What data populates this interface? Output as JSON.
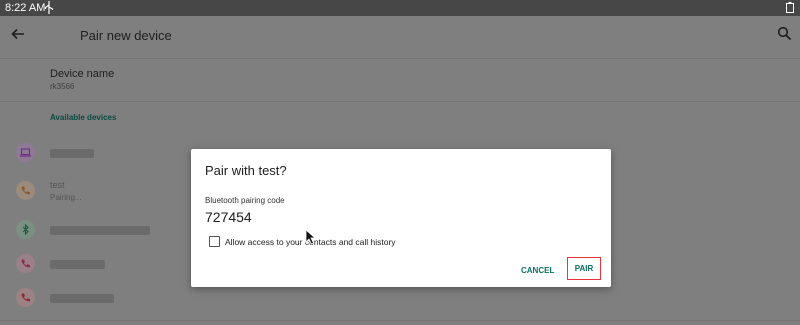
{
  "status_bar": {
    "time": "8:22 AM"
  },
  "header": {
    "title": "Pair new device"
  },
  "device_name": {
    "label": "Device name",
    "value": "rk3566"
  },
  "available_devices": {
    "title": "Available devices",
    "items": [
      {
        "icon": "laptop-icon",
        "name": "",
        "status": ""
      },
      {
        "icon": "phone-icon",
        "name": "test",
        "status": "Pairing..."
      },
      {
        "icon": "bluetooth-icon",
        "name": "",
        "status": ""
      },
      {
        "icon": "phone-icon",
        "name": "",
        "status": ""
      },
      {
        "icon": "phone-icon",
        "name": "",
        "status": ""
      }
    ]
  },
  "dialog": {
    "title": "Pair with test?",
    "code_label": "Bluetooth pairing code",
    "code": "727454",
    "checkbox_label": "Allow access to your contacts and call history",
    "checkbox_checked": false,
    "cancel_label": "CANCEL",
    "pair_label": "PAIR"
  },
  "colors": {
    "accent": "#0b6e5f",
    "highlight": "#e8323c"
  }
}
